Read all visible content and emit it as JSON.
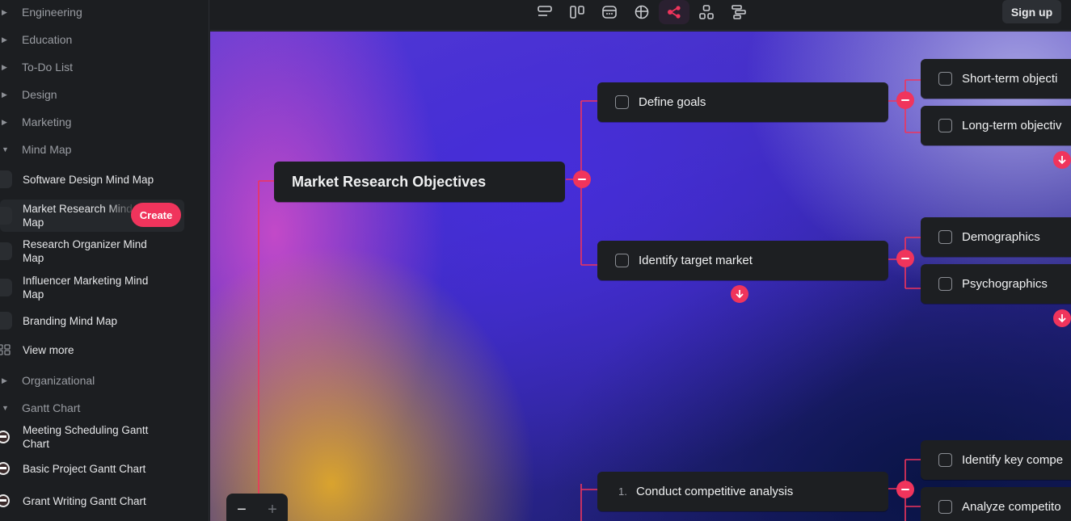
{
  "sidebar": {
    "categories": [
      {
        "label": "Engineering",
        "expanded": false
      },
      {
        "label": "Education",
        "expanded": false
      },
      {
        "label": "To-Do List",
        "expanded": false
      },
      {
        "label": "Design",
        "expanded": false
      },
      {
        "label": "Marketing",
        "expanded": false
      },
      {
        "label": "Mind Map",
        "expanded": true
      },
      {
        "label": "Organizational",
        "expanded": false
      },
      {
        "label": "Gantt Chart",
        "expanded": true
      }
    ],
    "mind_map_templates": [
      {
        "label": "Software Design Mind Map"
      },
      {
        "label": "Market Research Mind Map"
      },
      {
        "label": "Research Organizer Mind Map"
      },
      {
        "label": "Influencer Marketing Mind Map"
      },
      {
        "label": "Branding Mind Map"
      }
    ],
    "view_more": "View more",
    "gantt_templates": [
      {
        "label": "Meeting Scheduling Gantt Chart"
      },
      {
        "label": "Basic Project Gantt Chart"
      },
      {
        "label": "Grant Writing Gantt Chart"
      }
    ],
    "create_label": "Create"
  },
  "topbar": {
    "view_icons": [
      "outline-view-icon",
      "kanban-view-icon",
      "calendar-view-icon",
      "table-view-icon",
      "mindmap-view-icon",
      "org-chart-view-icon",
      "gantt-view-icon"
    ],
    "active_view": "mindmap-view-icon",
    "sign_up": "Sign up"
  },
  "mindmap": {
    "root": "Market Research Objectives",
    "nodes": [
      {
        "label": "Define goals",
        "children": [
          "Short-term objecti",
          "Long-term objectiv"
        ]
      },
      {
        "label": "Identify target market",
        "children": [
          "Demographics",
          "Psychographics"
        ]
      },
      {
        "label": "Conduct competitive analysis",
        "number": "1.",
        "children": [
          "Identify key compe",
          "Analyze competito"
        ]
      }
    ]
  },
  "zoom": {
    "minus": "−",
    "plus": "+"
  },
  "colors": {
    "accent": "#f0345c",
    "node_bg": "#1d1f22",
    "sidebar_bg": "#1c1e21"
  }
}
